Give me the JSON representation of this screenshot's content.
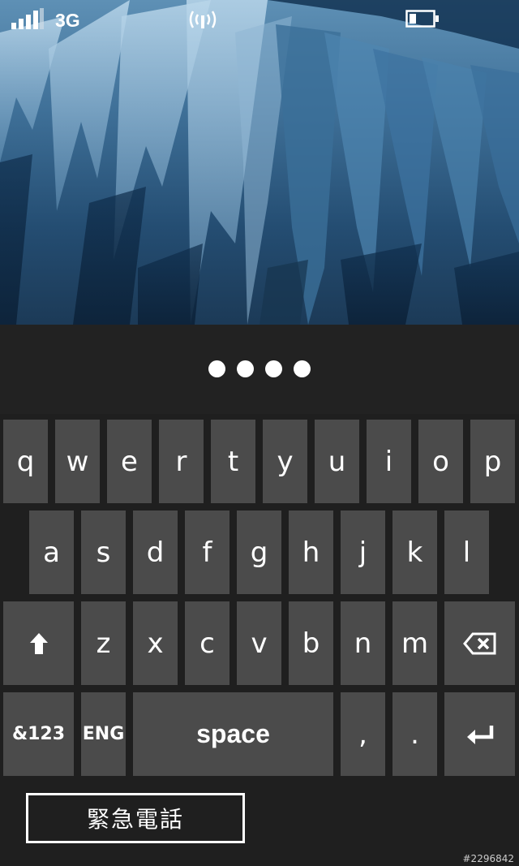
{
  "status_bar": {
    "network": "3G",
    "signal_bars": 4,
    "battery_level": 0.3
  },
  "pin": {
    "digits_entered": 4
  },
  "keyboard": {
    "row1": [
      "q",
      "w",
      "e",
      "r",
      "t",
      "y",
      "u",
      "i",
      "o",
      "p"
    ],
    "row2": [
      "a",
      "s",
      "d",
      "f",
      "g",
      "h",
      "j",
      "k",
      "l"
    ],
    "row3": [
      "z",
      "x",
      "c",
      "v",
      "b",
      "n",
      "m"
    ],
    "symbols_label": "&123",
    "language_label": "ENG",
    "space_label": "space",
    "comma_label": ",",
    "period_label": "."
  },
  "emergency_label": "緊急電話",
  "watermark": "#2296842"
}
